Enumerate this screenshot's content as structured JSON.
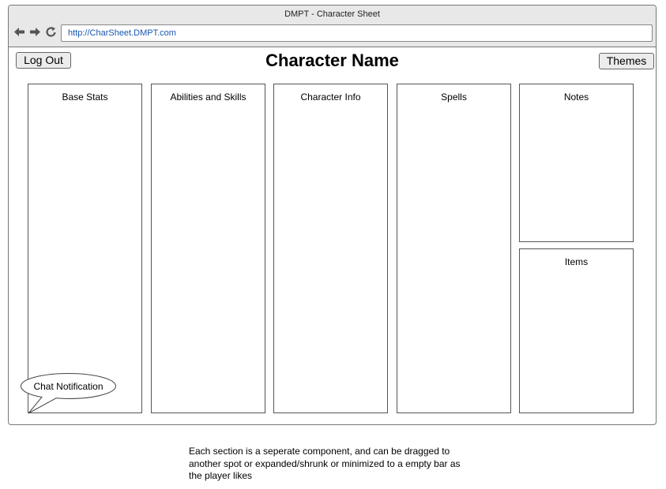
{
  "window": {
    "title": "DMPT - Character Sheet",
    "url": "http://CharSheet.DMPT.com"
  },
  "nav": {
    "back_icon": "arrow-left-icon",
    "forward_icon": "arrow-right-icon",
    "refresh_icon": "refresh-icon"
  },
  "header": {
    "logout_label": "Log Out",
    "title": "Character Name",
    "themes_label": "Themes"
  },
  "panels": {
    "base_stats": "Base Stats",
    "abilities": "Abilities and Skills",
    "character_info": "Character Info",
    "spells": "Spells",
    "notes": "Notes",
    "items": "Items"
  },
  "chat": {
    "label": "Chat Notification"
  },
  "note": {
    "text": "Each section is a seperate component, and can be dragged to another spot or expanded/shrunk or minimized to a empty bar as the player likes"
  }
}
